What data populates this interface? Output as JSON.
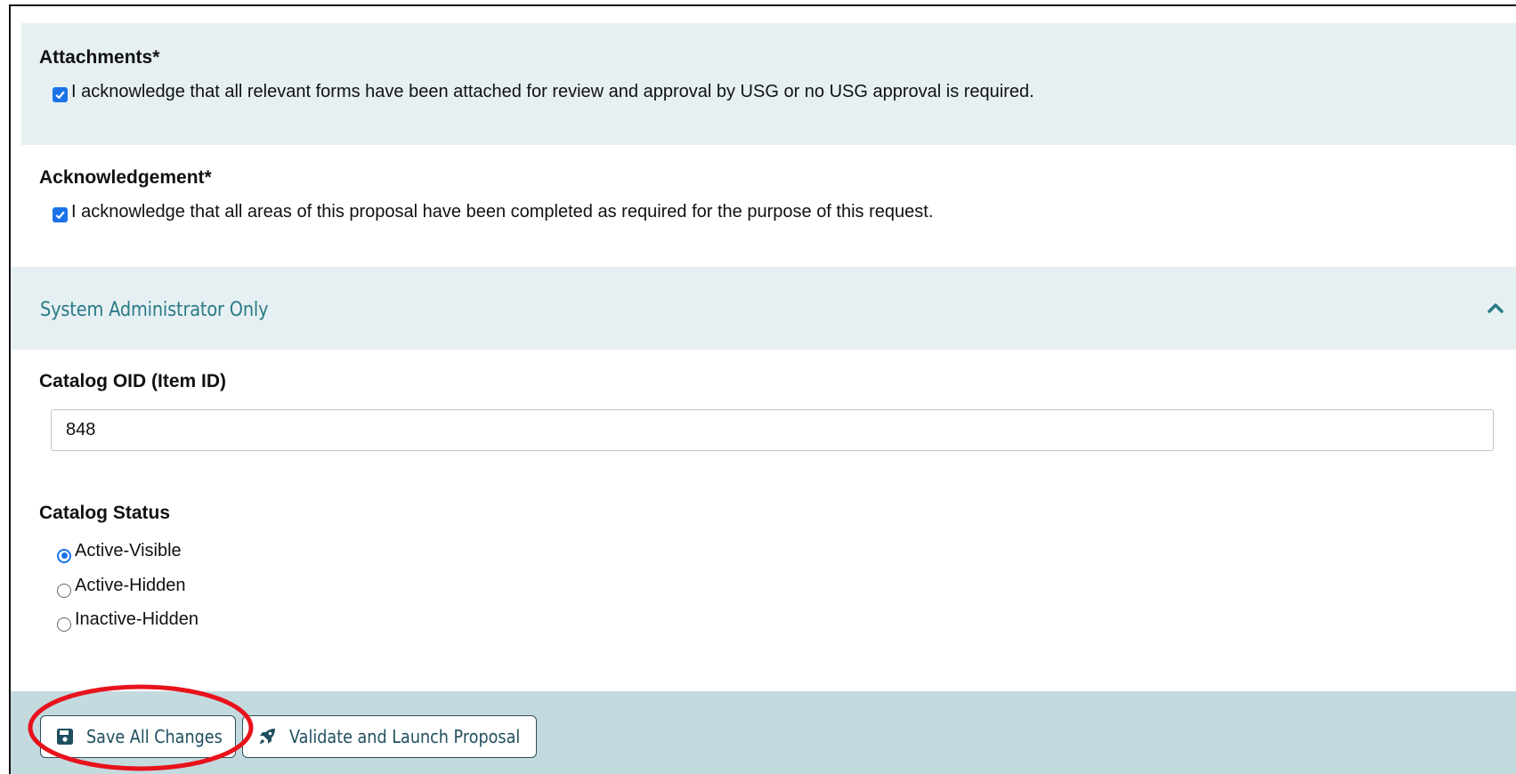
{
  "attachments": {
    "heading": "Attachments*",
    "checkbox_label": "I acknowledge that all relevant forms have been attached for review and approval by USG or no USG approval is required.",
    "checked": true
  },
  "acknowledgement": {
    "heading": "Acknowledgement*",
    "checkbox_label": "I acknowledge that all areas of this proposal have been completed as required for the purpose of this request.",
    "checked": true
  },
  "admin_section": {
    "title": "System Administrator Only",
    "icon": "chevron-up-icon",
    "accent_color": "#2a7a86",
    "background_color": "#e6f0f3"
  },
  "catalog_oid": {
    "label": "Catalog OID (Item ID)",
    "value": "848"
  },
  "catalog_status": {
    "label": "Catalog Status",
    "options": [
      "Active-Visible",
      "Active-Hidden",
      "Inactive-Hidden"
    ],
    "selected": "Active-Visible"
  },
  "footer": {
    "save_button": {
      "label": "Save All Changes",
      "icon": "floppy-disk-icon"
    },
    "launch_button": {
      "label": "Validate and Launch Proposal",
      "icon": "rocket-icon"
    },
    "background_color": "#c3dadf"
  },
  "annotation": {
    "shape": "red-ellipse",
    "target": "save-button",
    "color": "#e8121b"
  }
}
